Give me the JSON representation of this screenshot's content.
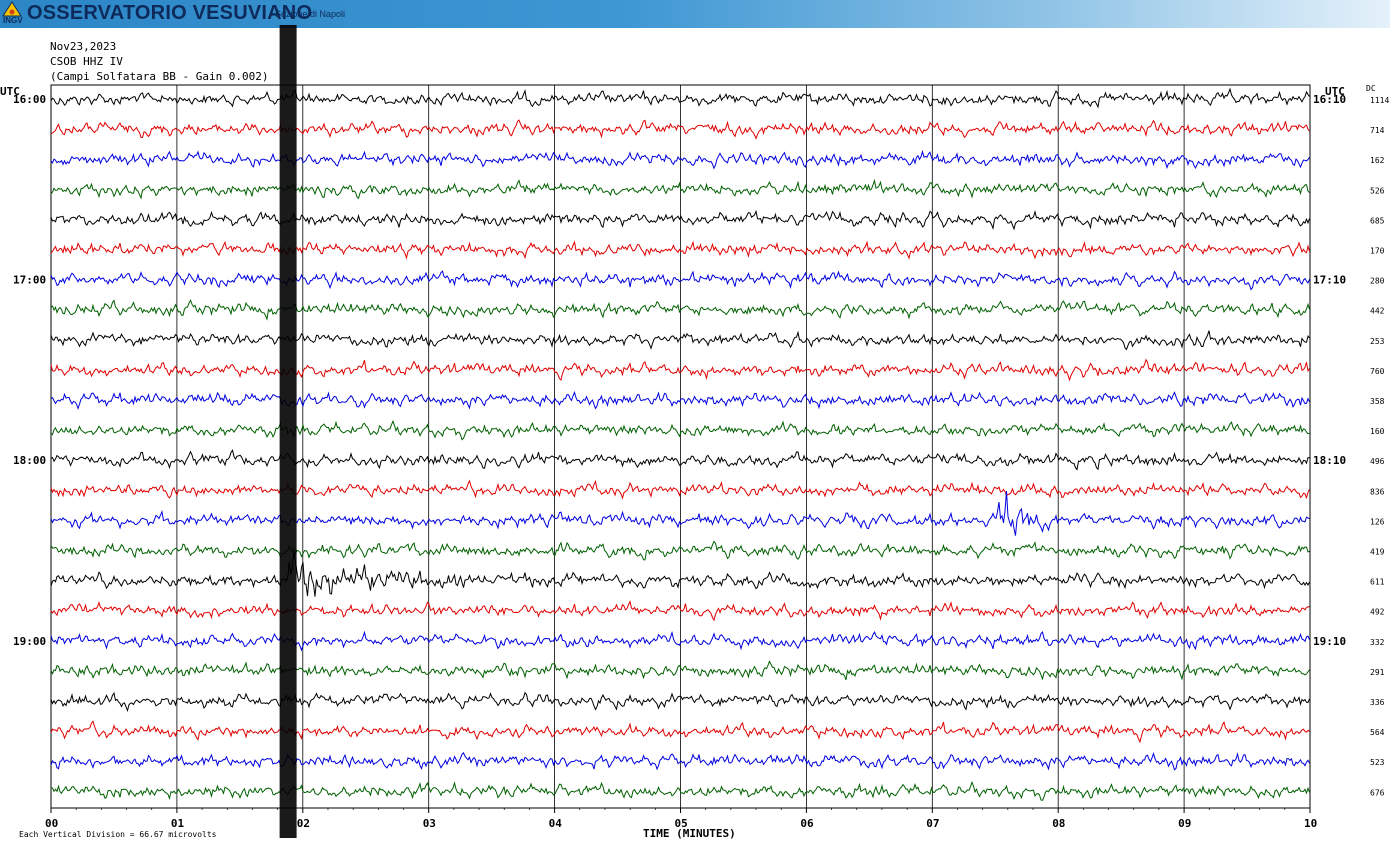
{
  "banner": {
    "title": "OSSERVATORIO VESUVIANO",
    "subtitle": "Sezione di Napoli",
    "logo_text": "INGV",
    "colors": {
      "start": "#2c86c6",
      "end": "#e4f1fa",
      "text": "#0d2a5a"
    }
  },
  "header": {
    "date": "Nov23,2023",
    "station": "CSOB HHZ IV",
    "description": "(Campi Solfatara BB - Gain 0.002)"
  },
  "labels": {
    "utc_left": "UTC",
    "utc_right": "UTC",
    "dc": "DC",
    "xlabel": "TIME (MINUTES)",
    "footer": "Each Vertical Division =   66.67 microvolts"
  },
  "chart_data": {
    "type": "line",
    "title": "",
    "xlabel": "TIME (MINUTES)",
    "xlim": [
      0,
      10
    ],
    "x_ticks": [
      "00",
      "01",
      "02",
      "03",
      "04",
      "05",
      "06",
      "07",
      "08",
      "09",
      "10"
    ],
    "trace_colors": [
      "#000000",
      "#e00000",
      "#0000e0",
      "#006000"
    ],
    "left_times": [
      "16:00",
      "",
      "",
      "",
      "",
      "",
      "17:00",
      "",
      "",
      "",
      "",
      "",
      "18:00",
      "",
      "",
      "",
      "",
      "",
      "19:00",
      "",
      "",
      "",
      "",
      ""
    ],
    "right_times": [
      "16:10",
      "",
      "",
      "",
      "",
      "",
      "17:10",
      "",
      "",
      "",
      "",
      "",
      "18:10",
      "",
      "",
      "",
      "",
      "",
      "19:10",
      "",
      "",
      "",
      "",
      ""
    ],
    "dc_values": [
      "1114",
      "714",
      "162",
      "526",
      "685",
      "170",
      "280",
      "442",
      "253",
      "760",
      "358",
      "160",
      "496",
      "836",
      "126",
      "419",
      "611",
      "492",
      "332",
      "291",
      "336",
      "564",
      "523",
      "676"
    ],
    "events": [
      {
        "row": 6,
        "minute": 4.6,
        "amp": 1.0,
        "duration": 0.12
      },
      {
        "row": 14,
        "minute": 7.52,
        "amp": 4.5,
        "duration": 0.45
      },
      {
        "row": 16,
        "minute": 1.9,
        "amp": 3.0,
        "duration": 1.5
      },
      {
        "row": 16,
        "minute": 3.75,
        "amp": 1.2,
        "duration": 0.12
      }
    ],
    "saturated_spike": {
      "minute_start": 1.82,
      "minute_end": 1.95
    }
  }
}
